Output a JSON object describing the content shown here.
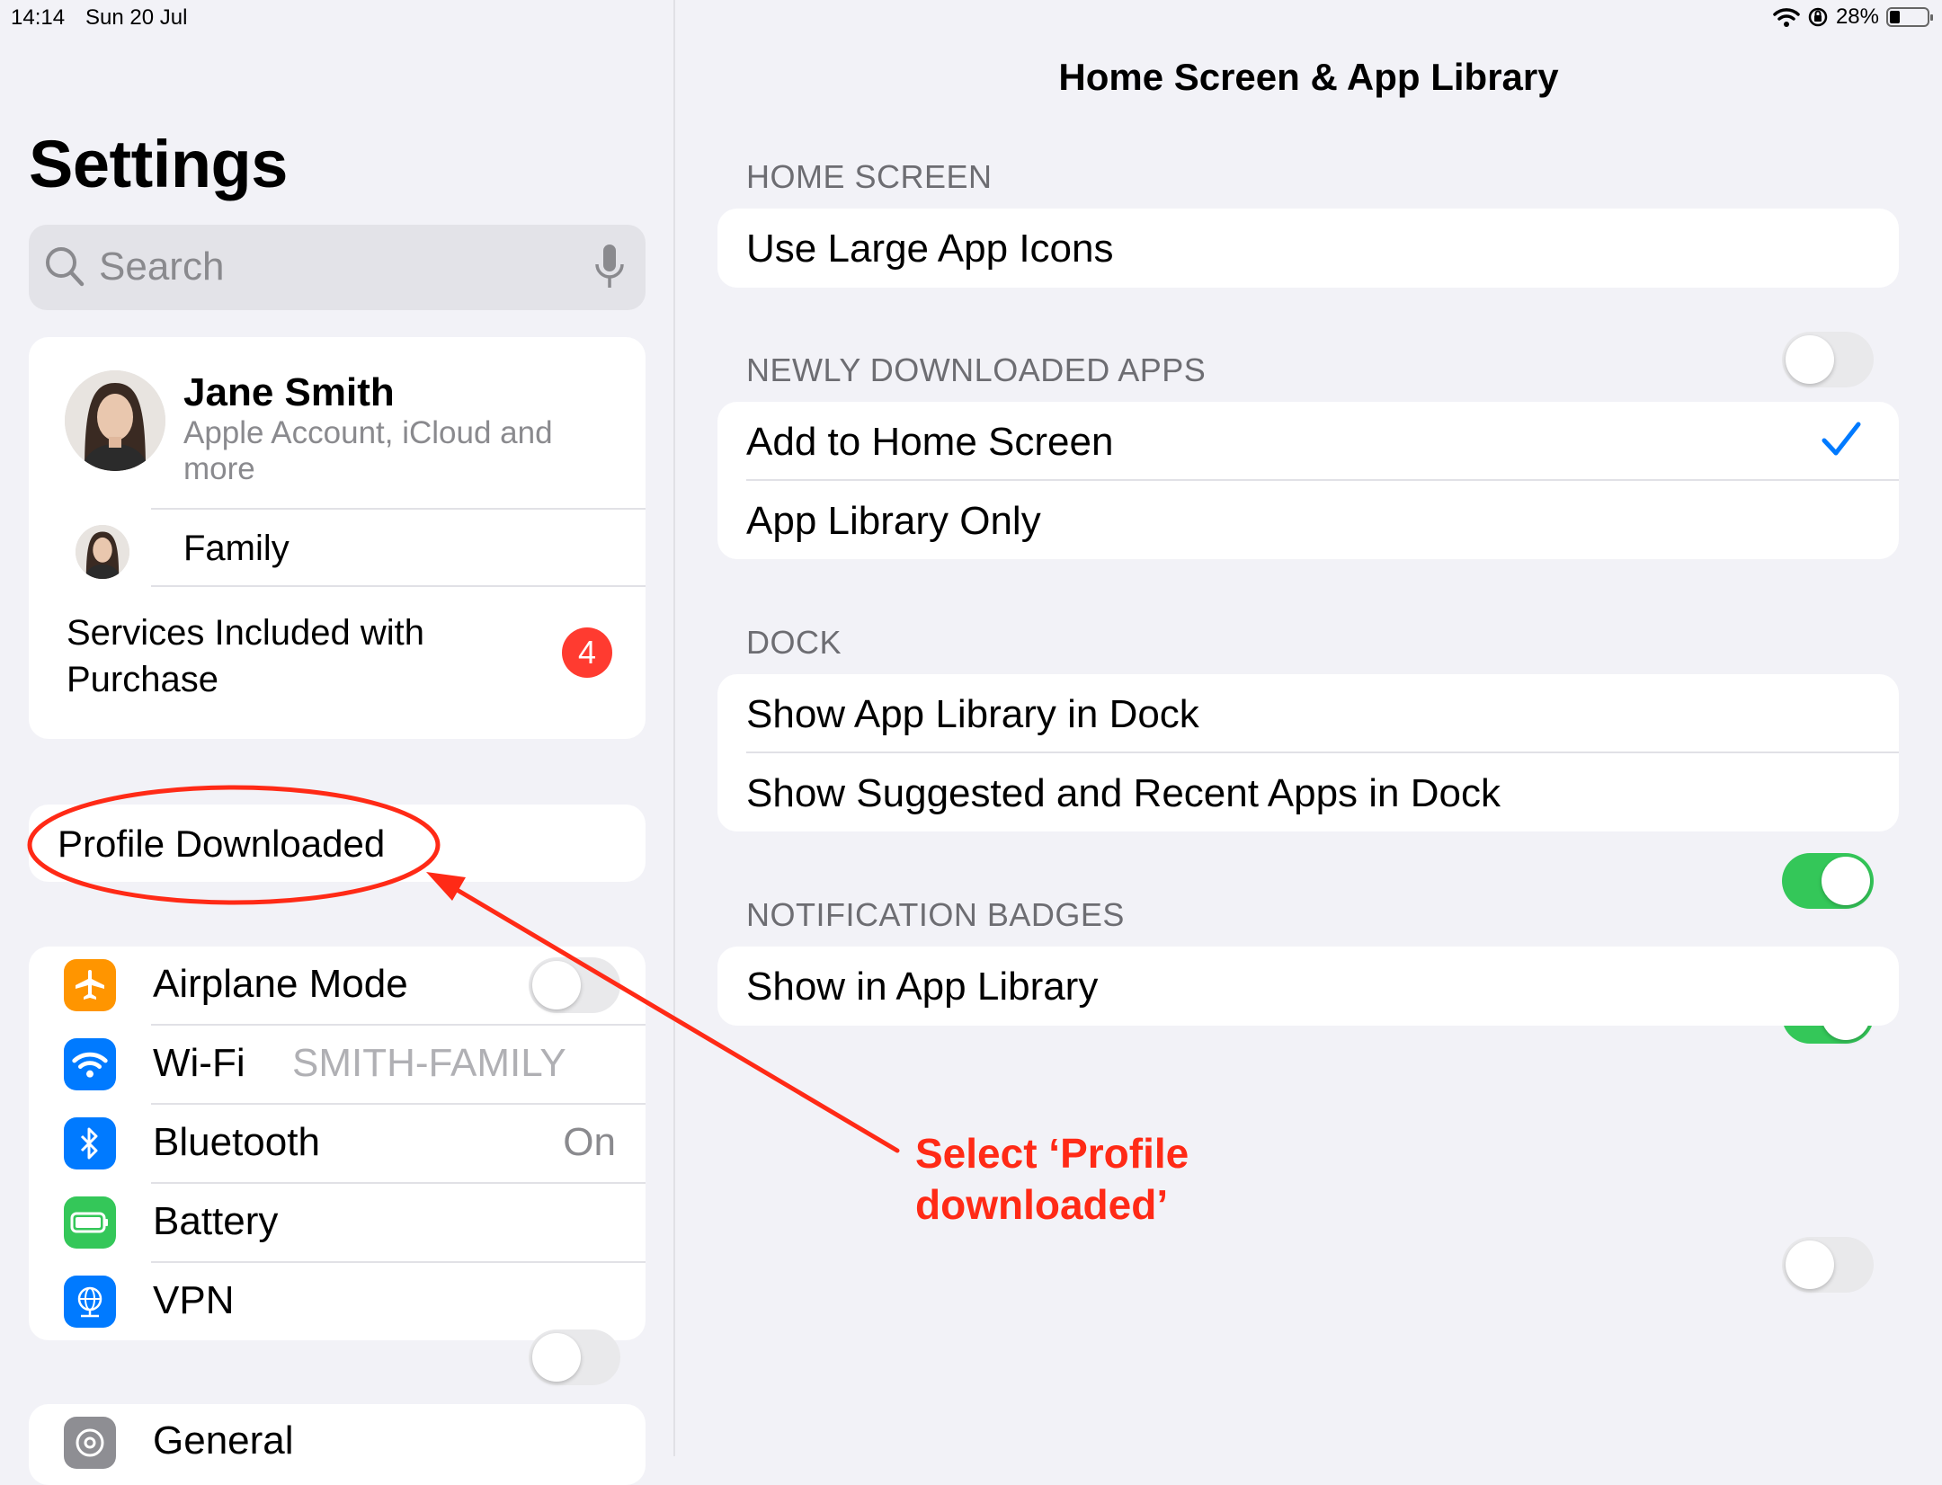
{
  "status_bar": {
    "time": "14:14",
    "date": "Sun 20 Jul",
    "battery_text": "28%",
    "battery_level": 0.28
  },
  "sidebar": {
    "title": "Settings",
    "search": {
      "placeholder": "Search"
    },
    "account": {
      "name": "Jane Smith",
      "subtitle": "Apple Account, iCloud and more",
      "family_label": "Family",
      "services_label": "Services Included with Purchase",
      "services_badge": "4"
    },
    "profile_label": "Profile Downloaded",
    "connectivity": [
      {
        "label": "Airplane Mode",
        "icon": "airplane-icon",
        "color": "#ff9500",
        "toggle": false
      },
      {
        "label": "Wi-Fi",
        "icon": "wifi-icon",
        "color": "#007aff",
        "value": "SMITH-FAMILY"
      },
      {
        "label": "Bluetooth",
        "icon": "bluetooth-icon",
        "color": "#007aff",
        "value": "On"
      },
      {
        "label": "Battery",
        "icon": "battery-icon",
        "color": "#34c759"
      },
      {
        "label": "VPN",
        "icon": "vpn-globe-icon",
        "color": "#007aff",
        "toggle": false
      }
    ],
    "general_label": "General"
  },
  "detail": {
    "title": "Home Screen & App Library",
    "sections": [
      {
        "header": "HOME SCREEN",
        "rows": [
          {
            "label": "Use Large App Icons",
            "toggle": false
          }
        ]
      },
      {
        "header": "NEWLY DOWNLOADED APPS",
        "rows": [
          {
            "label": "Add to Home Screen",
            "checked": true
          },
          {
            "label": "App Library Only",
            "checked": false
          }
        ]
      },
      {
        "header": "DOCK",
        "rows": [
          {
            "label": "Show App Library in Dock",
            "toggle": true
          },
          {
            "label": "Show Suggested and Recent Apps in Dock",
            "toggle": true
          }
        ]
      },
      {
        "header": "NOTIFICATION BADGES",
        "rows": [
          {
            "label": "Show in App Library",
            "toggle": false
          }
        ]
      }
    ]
  },
  "annotation": {
    "text_line1": "Select ‘Profile",
    "text_line2": "downloaded’",
    "color": "#ff2a16"
  },
  "colors": {
    "accent": "#007aff",
    "toggle_on": "#34c759",
    "badge": "#ff3b30"
  }
}
